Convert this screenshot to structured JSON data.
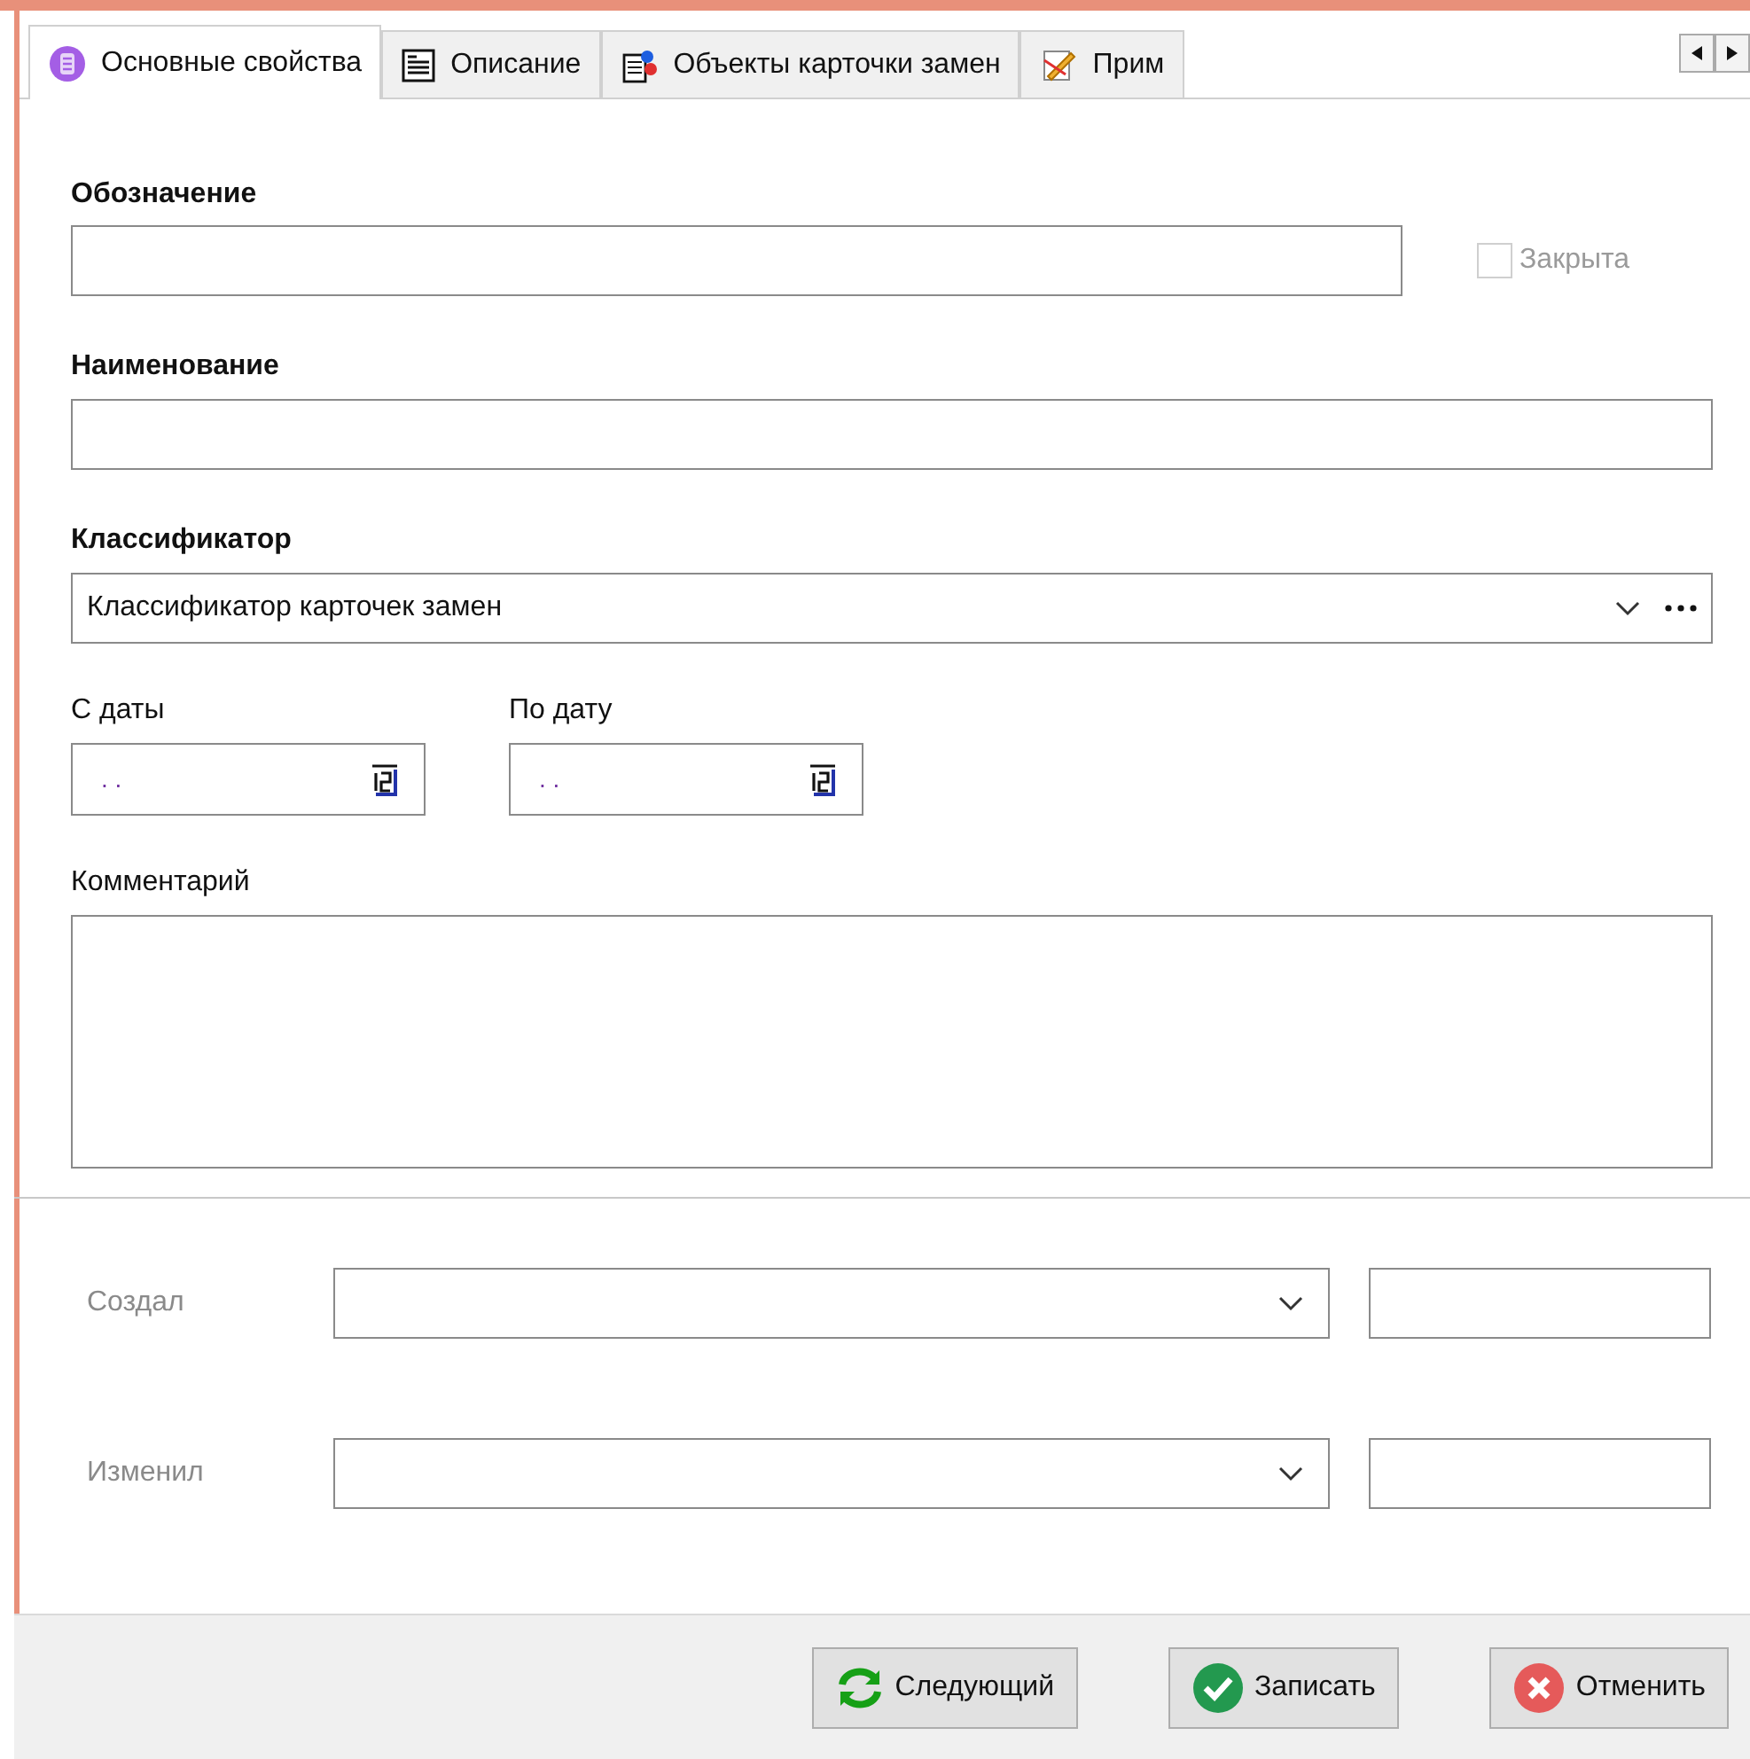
{
  "tabs": [
    {
      "label": "Основные свойства",
      "selected": true
    },
    {
      "label": "Описание",
      "selected": false
    },
    {
      "label": "Объекты карточки замен",
      "selected": false
    },
    {
      "label": "Прим",
      "selected": false
    }
  ],
  "designation": {
    "label": "Обозначение"
  },
  "closed": {
    "label": "Закрыта",
    "checked": false,
    "disabled": true
  },
  "name": {
    "label": "Наименование"
  },
  "classifier": {
    "label": "Классификатор",
    "value": "Классификатор карточек замен"
  },
  "dates": [
    {
      "label": "С даты",
      "value": ". ."
    },
    {
      "label": "По дату",
      "value": ". ."
    }
  ],
  "comment": {
    "label": "Комментарий"
  },
  "audit": [
    {
      "label": "Создал"
    },
    {
      "label": "Изменил"
    }
  ],
  "buttons": [
    {
      "label": "Следующий",
      "kind": "next"
    },
    {
      "label": "Записать",
      "kind": "save"
    },
    {
      "label": "Отменить",
      "kind": "cancel"
    }
  ]
}
